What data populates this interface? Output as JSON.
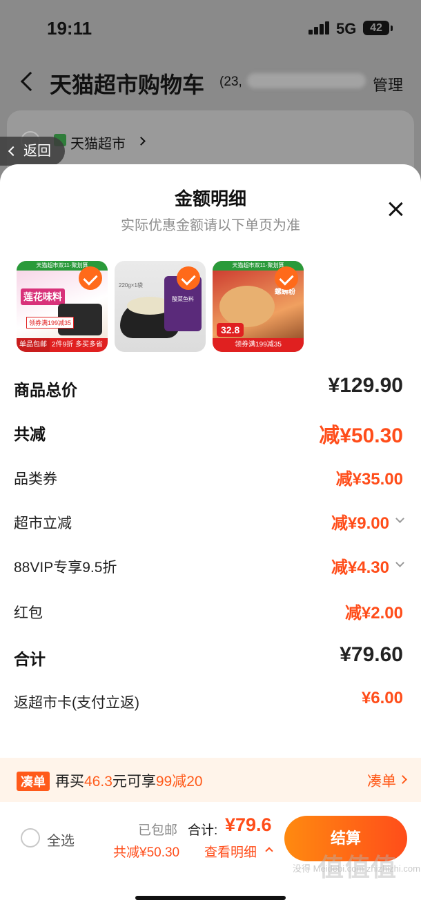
{
  "status_bar": {
    "time": "19:11",
    "network": "5G",
    "battery": "42"
  },
  "header": {
    "title": "天猫超市购物车",
    "count": "(23,",
    "manage": "管理"
  },
  "store": {
    "name": "天猫超市"
  },
  "return_button": {
    "label": "返回"
  },
  "sheet": {
    "title": "金额明细",
    "subtitle": "实际优惠金额请以下单页为准"
  },
  "thumbnails": [
    {
      "name": "莲花味料",
      "strip": "2件9折 多买多省",
      "top": "天猫超市双11·聚划算",
      "badge": "领券满199减35",
      "corner": "单品包邮"
    },
    {
      "name": "酸菜鱼料",
      "strip": "",
      "top": "220g×1袋",
      "badge": "",
      "corner": ""
    },
    {
      "name": "螺蛳粉",
      "strip": "领券满199减35",
      "top": "天猫超市双11·聚划算",
      "badge": "32.8",
      "corner": ""
    }
  ],
  "breakdown": {
    "goods_total": {
      "label": "商品总价",
      "value": "¥129.90"
    },
    "total_discount": {
      "label": "共减",
      "value": "减¥50.30"
    },
    "category_coupon": {
      "label": "品类券",
      "value": "减¥35.00"
    },
    "market_discount": {
      "label": "超市立减",
      "value": "减¥9.00"
    },
    "vip_discount": {
      "label": "88VIP专享9.5折",
      "value": "减¥4.30"
    },
    "red_packet": {
      "label": "红包",
      "value": "减¥2.00"
    },
    "sum": {
      "label": "合计",
      "value": "¥79.60"
    },
    "cashback": {
      "label": "返超市卡(支付立返)",
      "value": "¥6.00"
    }
  },
  "promo": {
    "tag": "凑单",
    "text_prefix": "再买",
    "amount": "46.3",
    "text_mid": "元可享",
    "offer": "99减20",
    "link": "凑单"
  },
  "bottom_bar": {
    "select_all": "全选",
    "shipping": "已包邮",
    "total_label": "合计:",
    "total_value": "¥79.6",
    "saved": "共减¥50.30",
    "detail_link": "查看明细",
    "checkout": "结算"
  },
  "watermark": {
    "text": "值值值",
    "sub": "没得 Meidebi.com zhizhizhi.com"
  },
  "colors": {
    "accent": "#ff4d1a",
    "checkout_gradient_start": "#ff8a10",
    "promo_bg": "#fff4ea"
  }
}
